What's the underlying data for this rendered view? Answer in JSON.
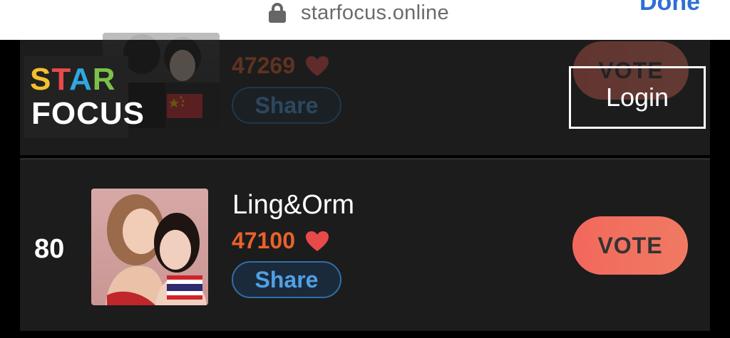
{
  "browser": {
    "url": "starfocus.online",
    "done_label": "Done"
  },
  "logo": {
    "star_letters": [
      "S",
      "T",
      "A",
      "R"
    ],
    "star_colors": [
      "#f2c12e",
      "#e84a4a",
      "#2fa8e0",
      "#7cc04a"
    ],
    "focus": "FOCUS"
  },
  "login_label": "Login",
  "rows": [
    {
      "rank": "",
      "name": "",
      "votes": "47269",
      "share_label": "Share",
      "vote_label": "VOTE",
      "flag": "china"
    },
    {
      "rank": "80",
      "name": "Ling&Orm",
      "votes": "47100",
      "share_label": "Share",
      "vote_label": "VOTE",
      "flag": "thailand"
    }
  ],
  "colors": {
    "vote_count": "#e8622c",
    "vote_button": "#f2685c",
    "share_text": "#4ea1e6",
    "heart": "#e84a4a"
  }
}
